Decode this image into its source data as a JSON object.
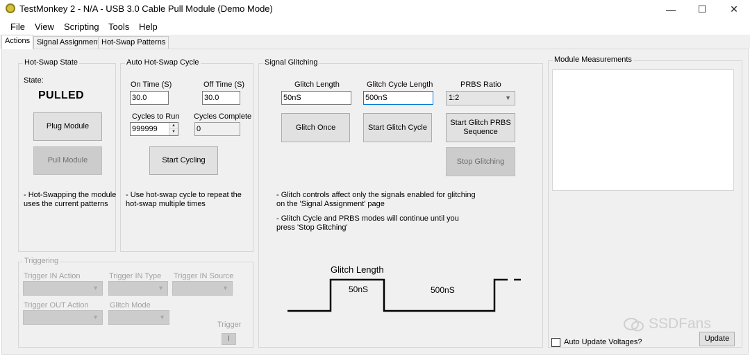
{
  "window": {
    "title": "TestMonkey 2 - N/A - USB 3.0 Cable Pull Module (Demo Mode)",
    "controls": {
      "minimize": "—",
      "maximize": "☐",
      "close": "✕"
    }
  },
  "menu": [
    "File",
    "View",
    "Scripting",
    "Tools",
    "Help"
  ],
  "tabs": [
    "Actions",
    "Signal Assignment",
    "Hot-Swap Patterns"
  ],
  "hot_swap_state": {
    "title": "Hot-Swap State",
    "state_label": "State:",
    "state_value": "PULLED",
    "plug_button": "Plug Module",
    "pull_button": "Pull Module",
    "note": "- Hot-Swapping the module\n  uses the current patterns"
  },
  "auto_cycle": {
    "title": "Auto Hot-Swap Cycle",
    "on_time_label": "On Time (S)",
    "on_time_value": "30.0",
    "off_time_label": "Off Time (S)",
    "off_time_value": "30.0",
    "cycles_to_run_label": "Cycles to Run",
    "cycles_to_run_value": "999999",
    "cycles_complete_label": "Cycles Complete",
    "cycles_complete_value": "0",
    "start_button": "Start Cycling",
    "note": "- Use hot-swap cycle to repeat the\n  hot-swap multiple times"
  },
  "signal_glitching": {
    "title": "Signal Glitching",
    "glitch_length_label": "Glitch Length",
    "glitch_length_value": "50nS",
    "glitch_cycle_label": "Glitch Cycle Length",
    "glitch_cycle_value": "500nS",
    "prbs_label": "PRBS Ratio",
    "prbs_value": "1:2",
    "glitch_once_button": "Glitch Once",
    "start_cycle_button": "Start Glitch Cycle",
    "start_prbs_button": "Start Glitch PRBS\nSequence",
    "stop_button": "Stop Glitching",
    "note1": "- Glitch controls affect only the signals enabled for glitching\n  on the 'Signal Assignment' page",
    "note2": "- Glitch Cycle and PRBS modes will continue until you\n  press 'Stop Glitching'",
    "diagram": {
      "title": "Glitch Length",
      "pulse_label": "50nS",
      "gap_label": "500nS"
    }
  },
  "triggering": {
    "title": "Triggering",
    "in_action_label": "Trigger IN Action",
    "in_type_label": "Trigger IN Type",
    "in_source_label": "Trigger IN Source",
    "out_action_label": "Trigger OUT Action",
    "glitch_mode_label": "Glitch Mode",
    "trigger_label": "Trigger",
    "trigger_button": "I"
  },
  "module_measurements": {
    "title": "Module Measurements",
    "auto_update_label": "Auto Update Voltages?",
    "update_button": "Update"
  },
  "watermark": "SSDFans",
  "icons": {
    "app": "monkey-app-icon",
    "watermark": "wechat-icon"
  },
  "colors": {
    "window_bg": "#f0f0f0",
    "disabled_text": "#a0a0a0",
    "focus_border": "#0078d7"
  }
}
